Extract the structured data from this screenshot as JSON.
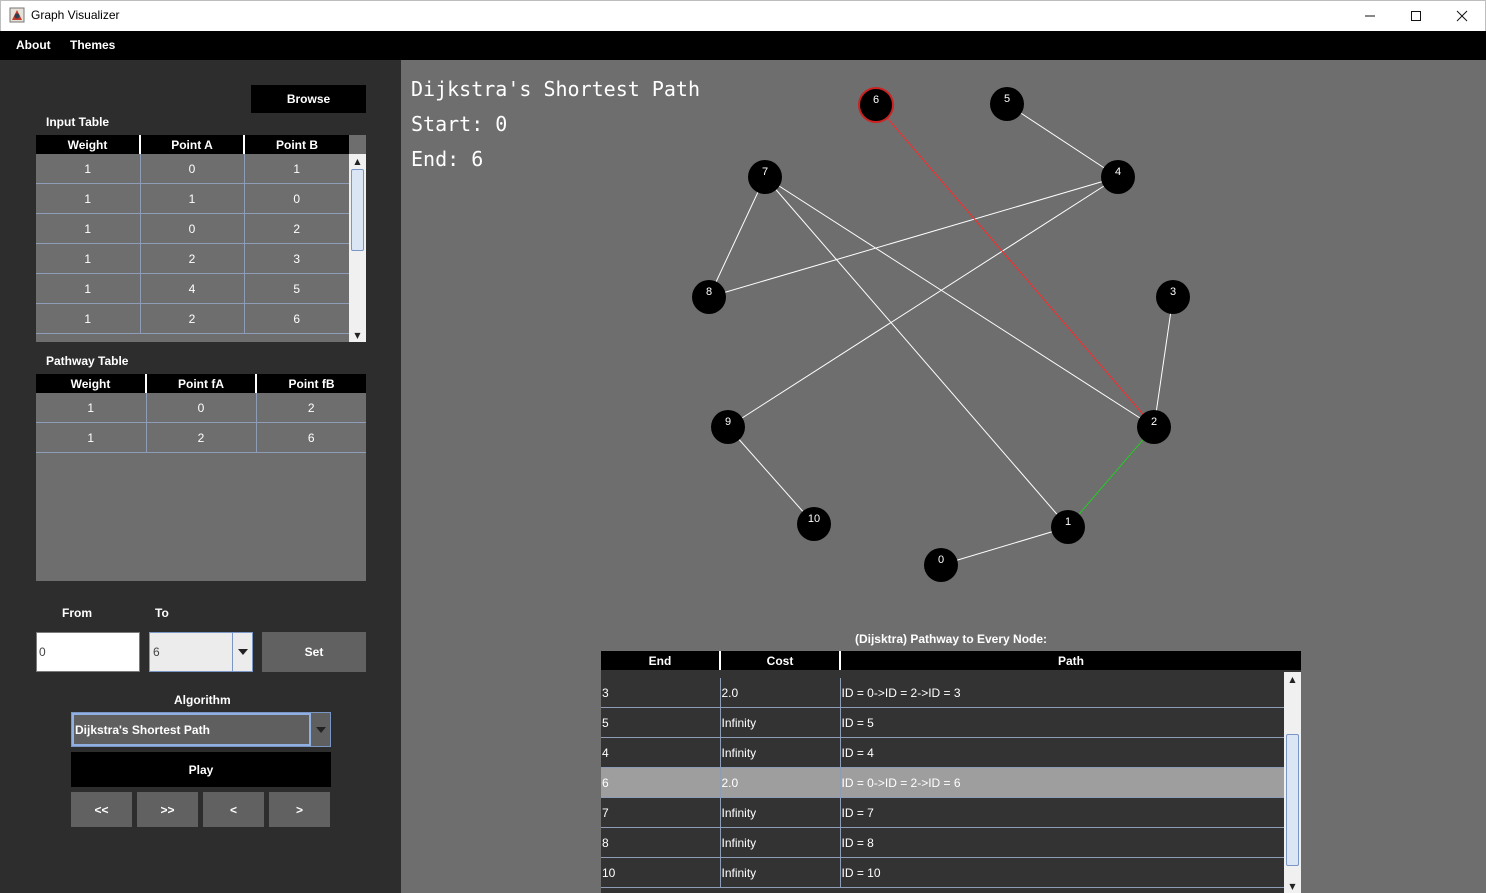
{
  "window": {
    "title": "Graph Visualizer",
    "minimize": "—",
    "maximize": "☐",
    "close": "✕"
  },
  "menu": [
    "About",
    "Themes"
  ],
  "left": {
    "browse_label": "Browse",
    "input_table": {
      "title": "Input Table",
      "columns": [
        "Weight",
        "Point A",
        "Point B"
      ],
      "rows": [
        [
          "1",
          "0",
          "1"
        ],
        [
          "1",
          "1",
          "0"
        ],
        [
          "1",
          "0",
          "2"
        ],
        [
          "1",
          "2",
          "3"
        ],
        [
          "1",
          "4",
          "5"
        ],
        [
          "1",
          "2",
          "6"
        ]
      ]
    },
    "pathway_table": {
      "title": "Pathway Table",
      "columns": [
        "Weight",
        "Point fA",
        "Point fB"
      ],
      "rows": [
        [
          "1",
          "0",
          "2"
        ],
        [
          "1",
          "2",
          "6"
        ]
      ]
    },
    "from_label": "From",
    "to_label": "To",
    "from_value": "0",
    "to_value": "6",
    "set_label": "Set",
    "algorithm_label": "Algorithm",
    "algorithm_value": "Dijkstra's Shortest Path",
    "play_label": "Play",
    "controls": [
      "<<",
      ">>",
      "<",
      ">"
    ]
  },
  "graph": {
    "title": "Dijkstra's Shortest Path",
    "start_text": "Start: 0",
    "end_text": "End: 6",
    "nodes": [
      "6",
      "5",
      "7",
      "4",
      "8",
      "3",
      "9",
      "2",
      "10",
      "1",
      "0"
    ],
    "colors": {
      "edge": "#ffffff",
      "path_edge": "#ff2a2a",
      "visited_edge": "#22cc22",
      "node": "#000000",
      "target_ring": "#cc2222"
    }
  },
  "results": {
    "title": "(Dijsktra) Pathway to Every Node:",
    "columns": [
      "End",
      "Cost",
      "Path"
    ],
    "rows": [
      [
        "3",
        "2.0",
        "ID = 0->ID = 2->ID = 3"
      ],
      [
        "5",
        "Infinity",
        "ID = 5"
      ],
      [
        "4",
        "Infinity",
        "ID = 4"
      ],
      [
        "6",
        "2.0",
        "ID = 0->ID = 2->ID = 6"
      ],
      [
        "7",
        "Infinity",
        "ID = 7"
      ],
      [
        "8",
        "Infinity",
        "ID = 8"
      ],
      [
        "10",
        "Infinity",
        "ID = 10"
      ]
    ],
    "selected_end": "6"
  }
}
